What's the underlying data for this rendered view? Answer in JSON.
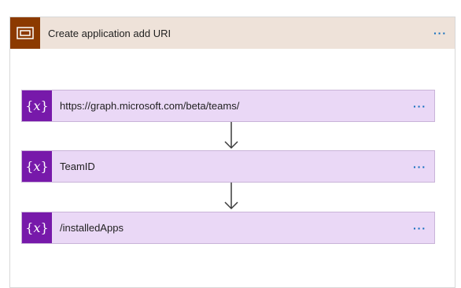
{
  "scope": {
    "title": "Create application add URI",
    "more_label": "···"
  },
  "actions": [
    {
      "title": "https://graph.microsoft.com/beta/teams/",
      "icon_text": "{x}",
      "more_label": "···"
    },
    {
      "title": "TeamID",
      "icon_text": "{x}",
      "more_label": "···"
    },
    {
      "title": "/installedApps",
      "icon_text": "{x}",
      "more_label": "···"
    }
  ],
  "colors": {
    "scope_header_bg": "#eee2d9",
    "scope_icon_bg": "#8c3a00",
    "variable_card_bg": "#ead8f6",
    "variable_icon_bg": "#7719aa",
    "more_dots": "#0f6cbd"
  },
  "icons": {
    "scope": "scope-icon",
    "variable": "variable-icon",
    "connector": "arrow-down-icon"
  }
}
